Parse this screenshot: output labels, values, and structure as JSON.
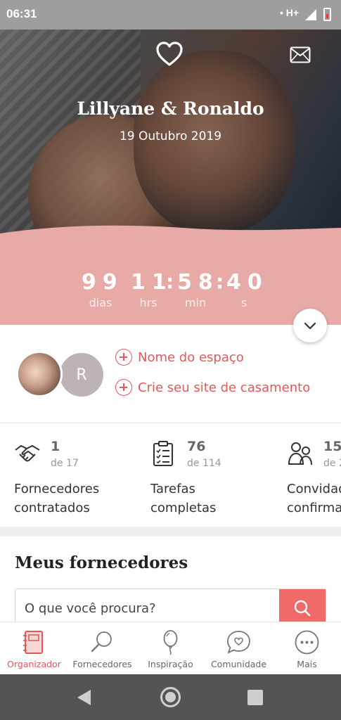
{
  "status_bar": {
    "time": "06:31",
    "network": "H+"
  },
  "hero": {
    "couple_name": "Lillyane & Ronaldo",
    "date": "19 Outubro 2019"
  },
  "countdown": {
    "days": "99",
    "days_label": "dias",
    "hours": "11",
    "hours_label": "hrs",
    "minutes": "58",
    "minutes_label": "min",
    "seconds": "40",
    "seconds_label": "s"
  },
  "profile": {
    "partner_initial": "R",
    "links": [
      {
        "label": "Nome do espaço"
      },
      {
        "label": "Crie seu site de casamento"
      }
    ]
  },
  "stats": [
    {
      "icon": "handshake-icon",
      "count": "1",
      "total": "de 17",
      "label_line1": "Fornecedores",
      "label_line2": "contratados"
    },
    {
      "icon": "clipboard-checklist-icon",
      "count": "76",
      "total": "de 114",
      "label_line1": "Tarefas",
      "label_line2": "completas"
    },
    {
      "icon": "guests-icon",
      "count": "15",
      "total": "de 2",
      "label_line1": "Convidad",
      "label_line2": "confirma"
    }
  ],
  "suppliers": {
    "title": "Meus fornecedores",
    "search_placeholder": "O que você procura?"
  },
  "bottom_nav": [
    {
      "label": "Organizador",
      "icon": "notebook-icon",
      "active": true
    },
    {
      "label": "Fornecedores",
      "icon": "search-icon",
      "active": false
    },
    {
      "label": "Inspiração",
      "icon": "balloon-icon",
      "active": false
    },
    {
      "label": "Comunidade",
      "icon": "chat-heart-icon",
      "active": false
    },
    {
      "label": "Mais",
      "icon": "more-icon",
      "active": false
    }
  ],
  "colors": {
    "accent": "#e05a5a",
    "countdown_bg": "#e8aaa6",
    "search_button": "#f06a6a"
  }
}
